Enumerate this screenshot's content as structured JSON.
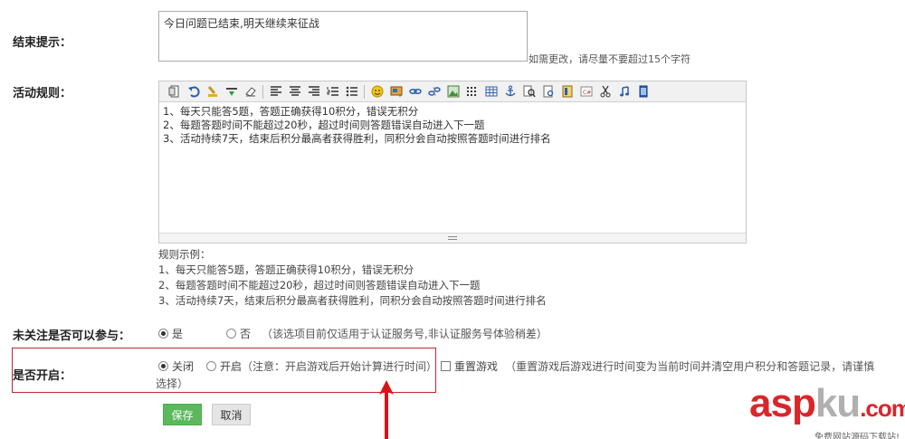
{
  "end_tip": {
    "label": "结束提示：",
    "value": "今日问题已结束,明天继续来征战",
    "hint": "如需更改，请尽量不要超过15个字符"
  },
  "rules": {
    "label": "活动规则：",
    "toolbar_icons": [
      "source-icon",
      "undo-icon",
      "clear-format-icon",
      "insert-below-icon",
      "eraser-icon",
      "align-left-icon",
      "align-center-icon",
      "align-right-icon",
      "ordered-list-icon",
      "unordered-list-icon",
      "emoji-icon",
      "image-insert-icon",
      "link-icon",
      "unlink-icon",
      "picture-icon",
      "special-char-icon",
      "table-icon",
      "anchor-icon",
      "find-icon",
      "preview-icon",
      "template-icon",
      "code-icon",
      "cut-icon",
      "music-icon",
      "video-icon"
    ],
    "content_lines": [
      "1、每天只能答5题，答题正确获得10积分，错误无积分",
      "2、每题答题时间不能超过20秒，超过时间则答题错误自动进入下一题",
      "3、活动持续7天，结束后积分最高者获得胜利，同积分会自动按照答题时间进行排名"
    ],
    "example_title": "规则示例：",
    "example_lines": [
      "1、每天只能答5题，答题正确获得10积分，错误无积分",
      "2、每题答题时间不能超过20秒，超过时间则答题错误自动进入下一题",
      "3、活动持续7天，结束后积分最高者获得胜利，同积分会自动按照答题时间进行排名"
    ]
  },
  "follow": {
    "label": "未关注是否可以参与：",
    "options": [
      "是",
      "否"
    ],
    "selected": "是",
    "note": "（该选项目前仅适用于认证服务号,非认证服务号体验稍差）"
  },
  "enable": {
    "label": "是否开启：",
    "options": [
      "关闭",
      "开启"
    ],
    "selected": "关闭",
    "open_note": "（注意：开启游戏后开始计算进行时间）",
    "reset_label": "重置游戏",
    "reset_note_line1": "（重置游戏后游戏进行时间变为当前时间并清空用户积分和答题记录，请谨慎",
    "reset_note_line2": "选择）"
  },
  "buttons": {
    "save": "保存",
    "cancel": "取消"
  },
  "watermark": {
    "asp": "asp",
    "ku": "ku",
    "com": ".com",
    "sub": "免费网站源码下载站!"
  },
  "colors": {
    "save_button": "#5cb85c",
    "highlight_frame": "#c0282e",
    "watermark_red": "#d9262b"
  }
}
